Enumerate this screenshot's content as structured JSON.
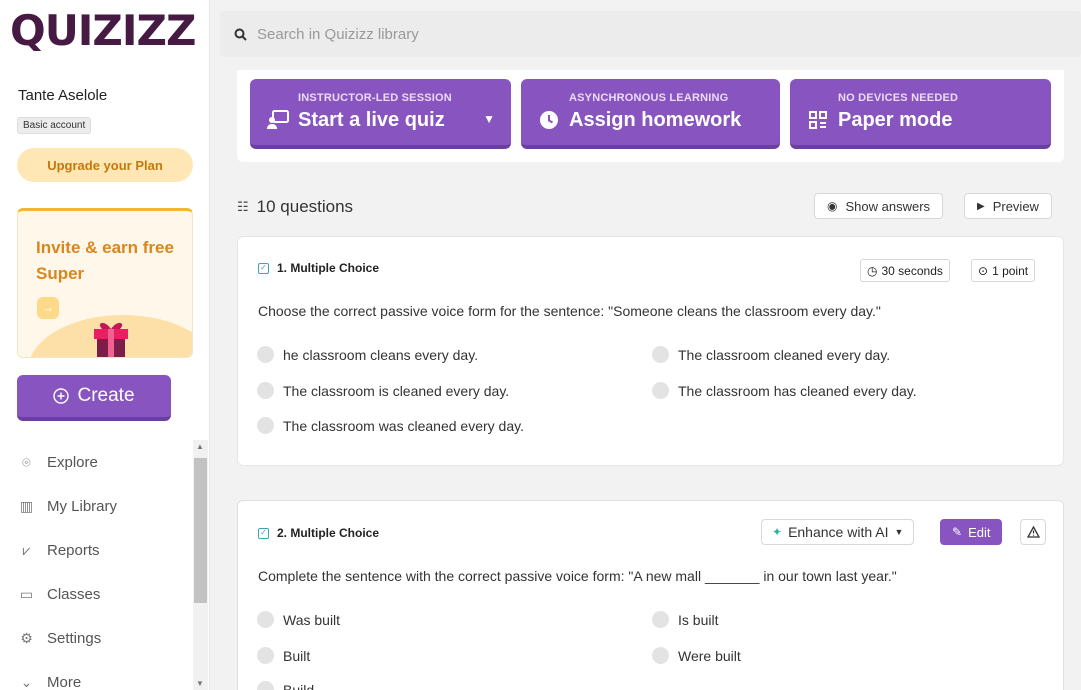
{
  "brand": {
    "logo": "QUIZIZZ",
    "accent": "#8854c0",
    "logo_color": "#461a42"
  },
  "user": {
    "name": "Tante Aselole",
    "account_type": "Basic account"
  },
  "sidebar": {
    "upgrade_label": "Upgrade your Plan",
    "invite": {
      "title": "Invite & earn free Super",
      "arrow_icon": "arrow-right-icon",
      "art_icon": "gift-icon"
    },
    "create_label": "Create",
    "nav": [
      {
        "label": "Explore",
        "icon": "compass-icon"
      },
      {
        "label": "My Library",
        "icon": "library-icon"
      },
      {
        "label": "Reports",
        "icon": "reports-icon"
      },
      {
        "label": "Classes",
        "icon": "classes-icon"
      },
      {
        "label": "Settings",
        "icon": "gear-icon"
      },
      {
        "label": "More",
        "icon": "chevron-down-icon"
      }
    ]
  },
  "search": {
    "placeholder": "Search in Quizizz library",
    "value": ""
  },
  "modes": [
    {
      "subtitle": "INSTRUCTOR-LED SESSION",
      "title": "Start a live quiz",
      "icon": "presenter-icon"
    },
    {
      "subtitle": "ASYNCHRONOUS LEARNING",
      "title": "Assign homework",
      "icon": "clock-icon"
    },
    {
      "subtitle": "NO DEVICES NEEDED",
      "title": "Paper mode",
      "icon": "paper-icon"
    }
  ],
  "questions_header": {
    "count_label": "10 questions",
    "show_answers_label": "Show answers",
    "preview_label": "Preview"
  },
  "questions": [
    {
      "type_label": "1. Multiple Choice",
      "time_label": "30 seconds",
      "points_label": "1 point",
      "text": "Choose the correct passive voice form for the sentence: \"Someone cleans the classroom every day.\"",
      "options": [
        "he classroom cleans every day.",
        "The classroom cleaned every day.",
        "The classroom is cleaned every day.",
        "The classroom has cleaned every day.",
        "The classroom was cleaned every day."
      ]
    },
    {
      "type_label": "2. Multiple Choice",
      "enhance_label": "Enhance with AI",
      "edit_label": "Edit",
      "text": "Complete the sentence with the correct passive voice form: \"A new mall _______ in our town last year.\"",
      "options": [
        "Was built",
        "Is built",
        "Built",
        "Were built",
        "Build"
      ]
    }
  ]
}
